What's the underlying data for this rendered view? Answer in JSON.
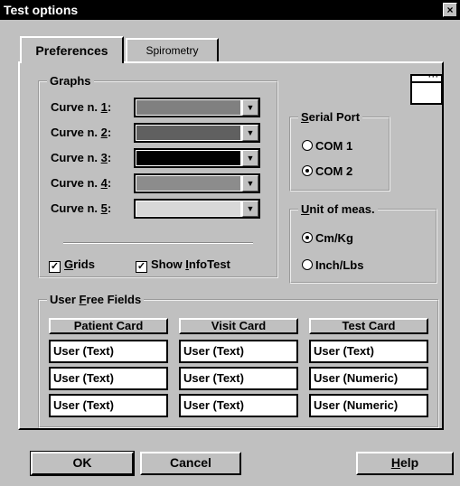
{
  "window": {
    "title": "Test options",
    "close_glyph": "×"
  },
  "tabs": [
    {
      "label": "Preferences",
      "active": true
    },
    {
      "label": "Spirometry",
      "active": false
    }
  ],
  "graphs": {
    "legend": "Graphs",
    "curves": [
      {
        "label_pre": "Curve n. ",
        "label_key": "1",
        "label_post": ":",
        "color": "#808080"
      },
      {
        "label_pre": "Curve n. ",
        "label_key": "2",
        "label_post": ":",
        "color": "#606060"
      },
      {
        "label_pre": "Curve n. ",
        "label_key": "3",
        "label_post": ":",
        "color": "#000000"
      },
      {
        "label_pre": "Curve n. ",
        "label_key": "4",
        "label_post": ":",
        "color": "#8c8c8c"
      },
      {
        "label_pre": "Curve n. ",
        "label_key": "5",
        "label_post": ":",
        "color": "#d8d8d8"
      }
    ],
    "grids": {
      "key": "G",
      "rest": "rids",
      "checked": true
    },
    "infotest": {
      "pre": "Show ",
      "key": "I",
      "rest": "nfoTest",
      "checked": true
    }
  },
  "serial": {
    "legend_key": "S",
    "legend_rest": "erial Port",
    "options": [
      {
        "label": "COM 1",
        "selected": false
      },
      {
        "label": "COM 2",
        "selected": true
      }
    ]
  },
  "unit": {
    "legend_key": "U",
    "legend_rest": "nit of meas.",
    "options": [
      {
        "label": "Cm/Kg",
        "selected": true
      },
      {
        "label": "Inch/Lbs",
        "selected": false
      }
    ]
  },
  "user_fields": {
    "legend_pre": "User ",
    "legend_key": "F",
    "legend_rest": "ree Fields",
    "columns": [
      "Patient Card",
      "Visit Card",
      "Test Card"
    ],
    "rows": [
      [
        "User (Text)",
        "User (Text)",
        "User (Text)"
      ],
      [
        "User (Text)",
        "User (Text)",
        "User (Numeric)"
      ],
      [
        "User (Text)",
        "User (Text)",
        "User (Numeric)"
      ]
    ]
  },
  "buttons": {
    "ok": "OK",
    "cancel": "Cancel",
    "help_key": "H",
    "help_rest": "elp"
  },
  "icons": {
    "window_preview": "window-icon",
    "checkmark": "✓"
  }
}
